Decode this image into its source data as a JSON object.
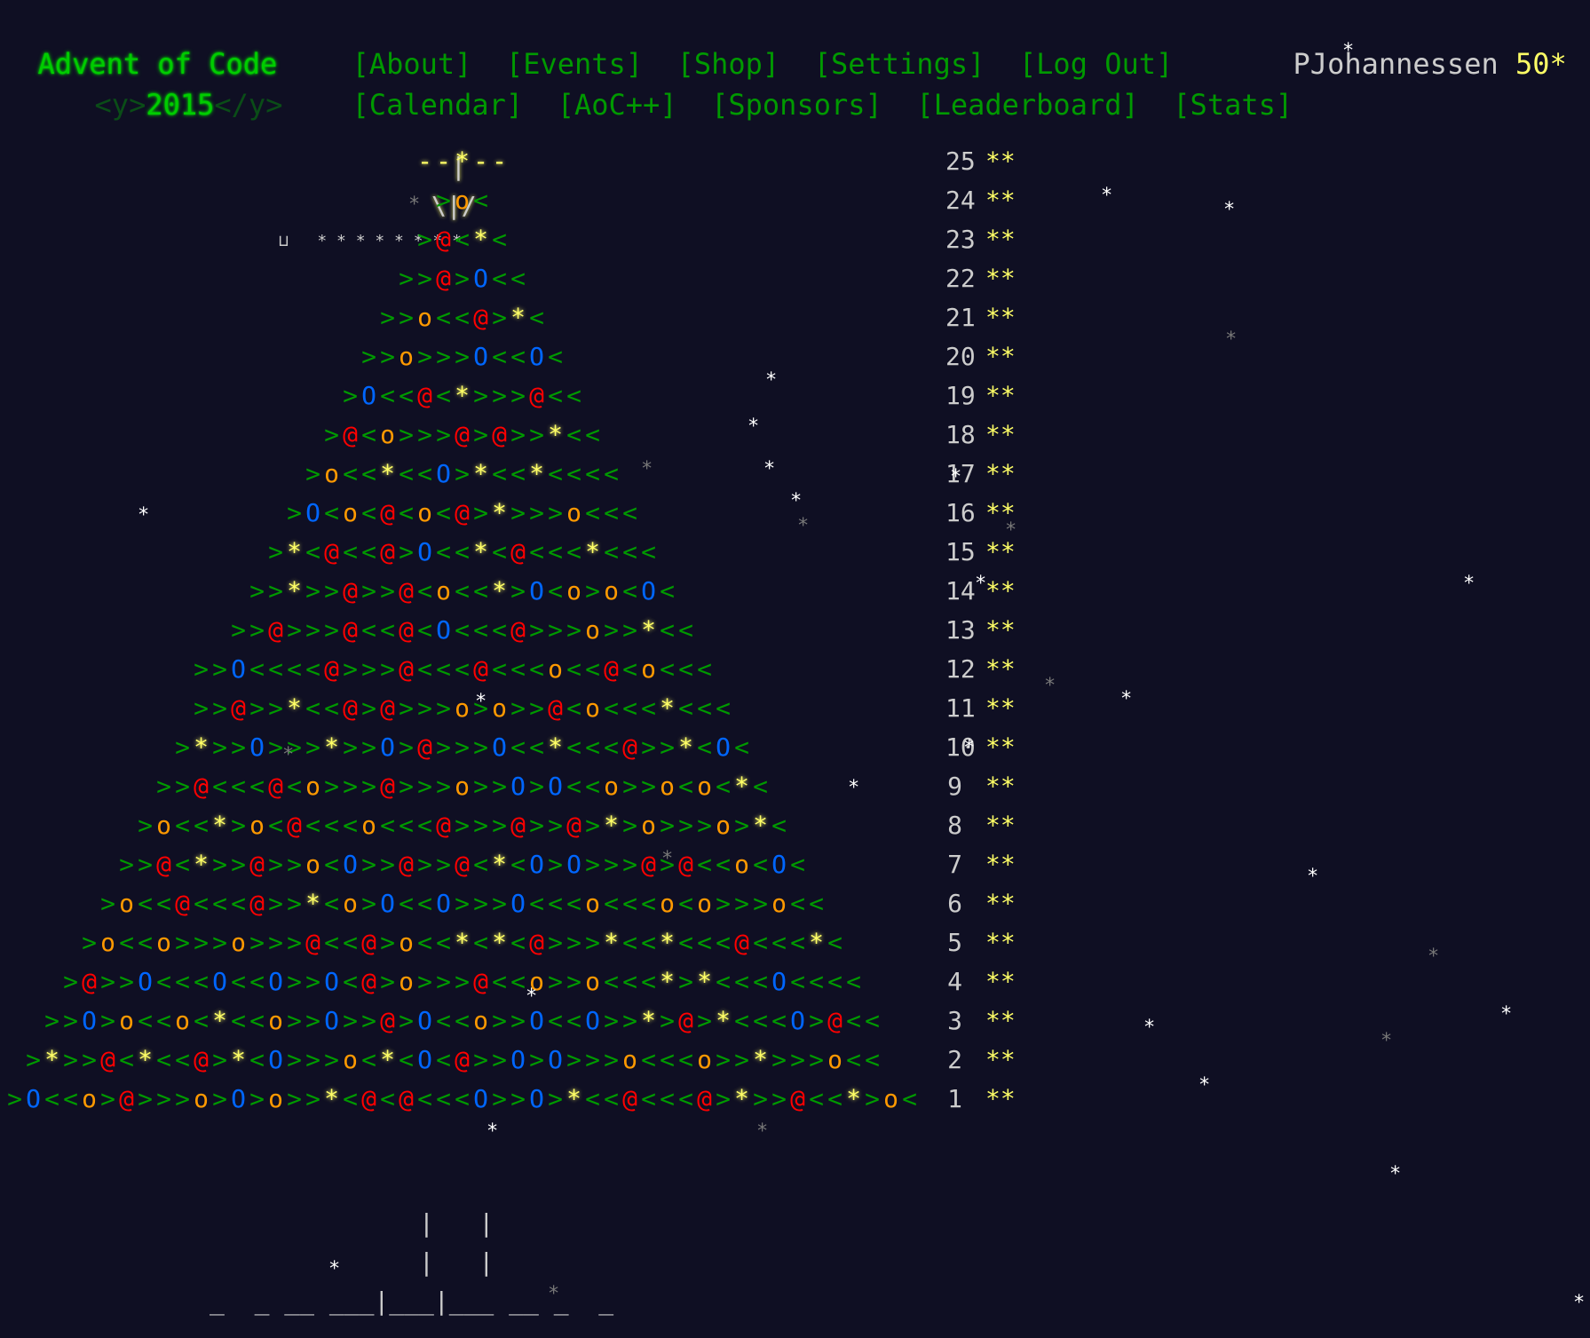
{
  "header": {
    "title": "Advent of Code",
    "year_prefix": "<y>",
    "year": "2015",
    "year_suffix": "</y>",
    "nav_row1": [
      "[About]",
      "[Events]",
      "[Shop]",
      "[Settings]",
      "[Log Out]"
    ],
    "nav_row2": [
      "[Calendar]",
      "[AoC++]",
      "[Sponsors]",
      "[Leaderboard]",
      "[Stats]"
    ],
    "user": "PJohannessen",
    "stars": "50*"
  },
  "calendar": {
    "top": [
      "|",
      "\\|/"
    ],
    "rows": [
      {
        "day": "25",
        "stars": "**",
        "art": "--*--"
      },
      {
        "day": "24",
        "stars": "**",
        "art": ">o<"
      },
      {
        "day": "23",
        "stars": "**",
        "art": ">@<*<"
      },
      {
        "day": "22",
        "stars": "**",
        "art": ">>@>O<<"
      },
      {
        "day": "21",
        "stars": "**",
        "art": ">>o<<@>*<"
      },
      {
        "day": "20",
        "stars": "**",
        "art": ">>o>>>O<<O<"
      },
      {
        "day": "19",
        "stars": "**",
        "art": ">O<<@<*>>>@<<"
      },
      {
        "day": "18",
        "stars": "**",
        "art": ">@<o>>>@>@>>*<<"
      },
      {
        "day": "17",
        "stars": "**",
        "art": ">o<<*<<O>*<<*<<<<"
      },
      {
        "day": "16",
        "stars": "**",
        "art": ">O<o<@<o<@>*>>>o<<<"
      },
      {
        "day": "15",
        "stars": "**",
        "art": ">*<@<<@>O<<*<@<<<*<<<"
      },
      {
        "day": "14",
        "stars": "**",
        "art": ">>*>>@>>@<o<<*>O<o>o<O<"
      },
      {
        "day": "13",
        "stars": "**",
        "art": ">>@>>>@<<@<O<<<@>>>o>>*<<"
      },
      {
        "day": "12",
        "stars": "**",
        "art": ">>O<<<<@>>>@<<<@<<<o<<@<o<<<"
      },
      {
        "day": "11",
        "stars": "**",
        "art": ">>@>>*<<@>@>>>o>o>>@<o<<<*<<<"
      },
      {
        "day": "10",
        "stars": "**",
        "art": ">*>>O>>>*>>O>@>>>O<<*<<<@>>*<O<"
      },
      {
        "day": "9",
        "stars": "**",
        "art": ">>@<<<@<o>>>@>>>o>>O>O<<o>>o<o<*<"
      },
      {
        "day": "8",
        "stars": "**",
        "art": ">o<<*>o<@<<<o<<<@>>>@>>@>*>o>>>o>*<"
      },
      {
        "day": "7",
        "stars": "**",
        "art": ">>@<*>>@>>o<O>>@>>@<*<O>O>>>@>@<<o<O<"
      },
      {
        "day": "6",
        "stars": "**",
        "art": ">o<<@<<<@>>*<o>O<<O>>>O<<<o<<<o<o>>>o<<"
      },
      {
        "day": "5",
        "stars": "**",
        "art": ">o<<o>>>o>>>@<<@>o<<*<*<@>>>*<<*<<<@<<<*<"
      },
      {
        "day": "4",
        "stars": "**",
        "art": ">@>>O<<<O<<O>>O<@>o>>>@<<o>>o<<<*>*<<<O<<<<"
      },
      {
        "day": "3",
        "stars": "**",
        "art": ">>O>o<<o<*<<o>>O>>@>O<<o>>O<<O>>*>@>*<<<O>@<<"
      },
      {
        "day": "2",
        "stars": "**",
        "art": ">*>>@<*<<@>*<O>>>o<*<O<@>>O>O>>>o<<<o>>*>>>o<<"
      },
      {
        "day": "1",
        "stars": "**",
        "art": ">O<<o>@>>>o>O>o>>*<@<@<<<O>>O>*<<@<<<@>*>>@<<*>o<"
      }
    ],
    "trunk": [
      "|   |",
      "|   |",
      "_  _ __ ___|___|___ __ _  _"
    ]
  }
}
